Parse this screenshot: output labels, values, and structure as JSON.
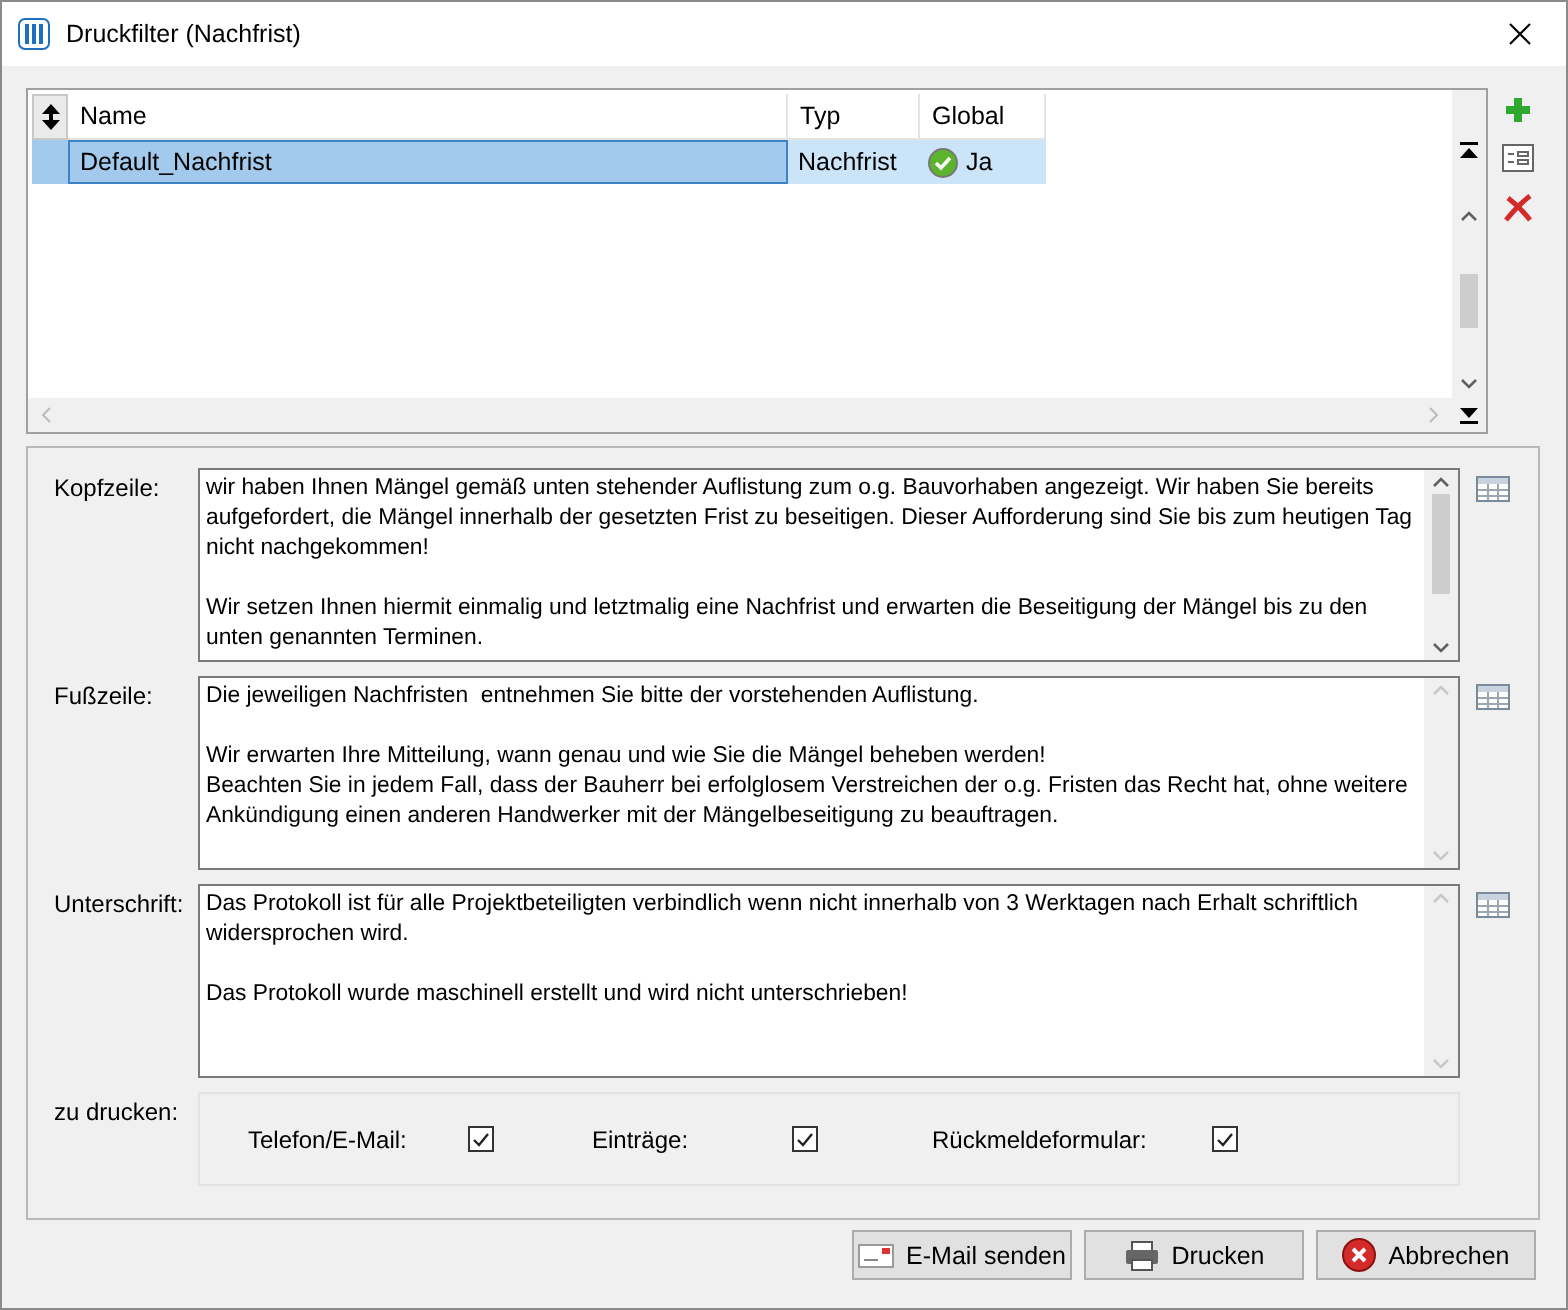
{
  "window": {
    "title": "Druckfilter  (Nachfrist)"
  },
  "table": {
    "columns": [
      "Name",
      "Typ",
      "Global"
    ],
    "rows": [
      {
        "name": "Default_Nachfrist",
        "type": "Nachfrist",
        "global": "Ja",
        "global_checked": true,
        "selected": true
      }
    ]
  },
  "fields": [
    {
      "label": "Kopfzeile:",
      "value": "wir haben Ihnen Mängel gemäß unten stehender Auflistung zum o.g. Bauvorhaben angezeigt. Wir haben Sie bereits aufgefordert, die Mängel innerhalb der gesetzten Frist zu beseitigen. Dieser Aufforderung sind Sie bis zum heutigen Tag nicht nachgekommen!\n\nWir setzen Ihnen hiermit einmalig und letztmalig eine Nachfrist und erwarten die Beseitigung der Mängel bis zu den unten genannten Terminen.",
      "scrollable": true
    },
    {
      "label": "Fußzeile:",
      "value": "Die jeweiligen Nachfristen  entnehmen Sie bitte der vorstehenden Auflistung.\n\nWir erwarten Ihre Mitteilung, wann genau und wie Sie die Mängel beheben werden!\nBeachten Sie in jedem Fall, dass der Bauherr bei erfolglosem Verstreichen der o.g. Fristen das Recht hat, ohne weitere Ankündigung einen anderen Handwerker mit der Mängelbeseitigung zu beauftragen.",
      "scrollable": false
    },
    {
      "label": "Unterschrift:",
      "value": "Das Protokoll ist für alle Projektbeteiligten verbindlich wenn nicht innerhalb von 3 Werktagen nach Erhalt schriftlich widersprochen wird.\n\nDas Protokoll wurde maschinell erstellt und wird nicht unterschrieben!",
      "scrollable": false
    }
  ],
  "print_options": {
    "label": "zu drucken:",
    "options": [
      {
        "label": "Telefon/E-Mail:",
        "checked": true
      },
      {
        "label": "Einträge:",
        "checked": true
      },
      {
        "label": "Rückmeldeformular:",
        "checked": true
      }
    ]
  },
  "buttons": [
    {
      "kind": "email",
      "label": "E-Mail senden"
    },
    {
      "kind": "print",
      "label": "Drucken"
    },
    {
      "kind": "cancel",
      "label": "Abbrechen"
    }
  ]
}
